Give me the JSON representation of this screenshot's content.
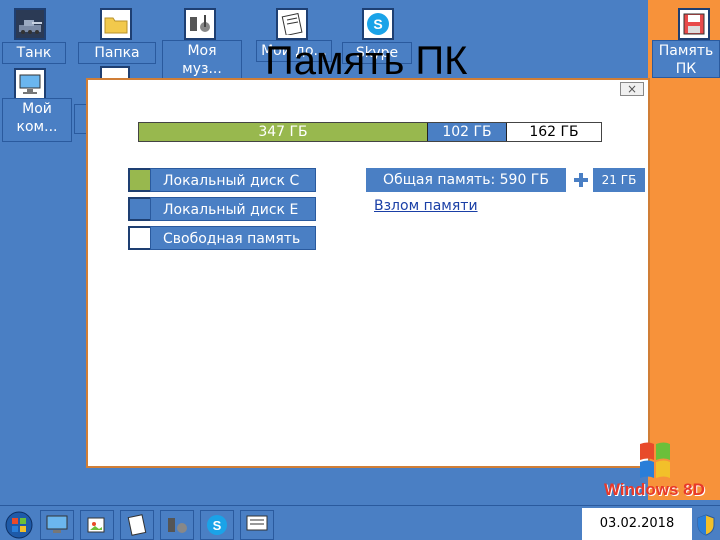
{
  "page_title": "Память ПК",
  "desktop_icons": {
    "tank": "Танк",
    "folder": "Папка",
    "music": "Моя муз...",
    "docs": "Мои до...",
    "skype": "Skype",
    "my_computer": "Мой ком...",
    "pc_memory": "Память ПК"
  },
  "window": {
    "close": "×",
    "bar": {
      "disk_c": "347 ГБ",
      "disk_e": "102 ГБ",
      "free": "162 ГБ"
    },
    "legend": {
      "disk_c": "Локальный диск С",
      "disk_e": "Локальный диск Е",
      "free": "Свободная память"
    },
    "total": "Общая память: 590 ГБ",
    "extra": "21 ГБ",
    "hack_link": "Взлом памяти"
  },
  "logo_text": "Windows 8D",
  "taskbar": {
    "clock": "03.02.2018"
  },
  "colors": {
    "desktop": "#4a7fc4",
    "accent": "#f7923a",
    "disk_c": "#98b84e",
    "disk_e": "#4a7fc4",
    "free": "#ffffff"
  }
}
